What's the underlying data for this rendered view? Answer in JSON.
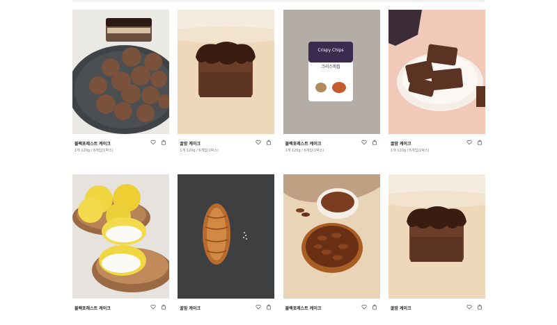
{
  "products": [
    {
      "name": "블랙포레스트 케이크",
      "desc": "1개 120g / 6개입(1박스)",
      "image": "chocolate-truffle-cakes"
    },
    {
      "name": "꿀밤 케이크",
      "desc": "1개 120g / 6개입(1박스)",
      "image": "chocolate-pound-cake"
    },
    {
      "name": "블랙포레스트 케이크",
      "desc": "1개 120g / 6개입(1박스)",
      "image": "crispy-chips-pouch"
    },
    {
      "name": "꿀밤 케이크",
      "desc": "1개 120g / 6개입(1박스)",
      "image": "chocolate-bars-plate"
    },
    {
      "name": "블랙포레스트 케이크",
      "desc": "",
      "image": "yellow-mochi-bowls"
    },
    {
      "name": "꿀밤 케이크",
      "desc": "",
      "image": "salt-bread-roll"
    },
    {
      "name": "블랙포레스트 케이크",
      "desc": "",
      "image": "pecan-tart"
    },
    {
      "name": "꿀밤 케이크",
      "desc": "",
      "image": "chocolate-pound-cake"
    }
  ],
  "chips_pack": {
    "brand": "Crispy Chips",
    "label": "크리스피칩"
  },
  "icons": {
    "wishlist": "heart-icon",
    "cart": "bag-icon"
  }
}
